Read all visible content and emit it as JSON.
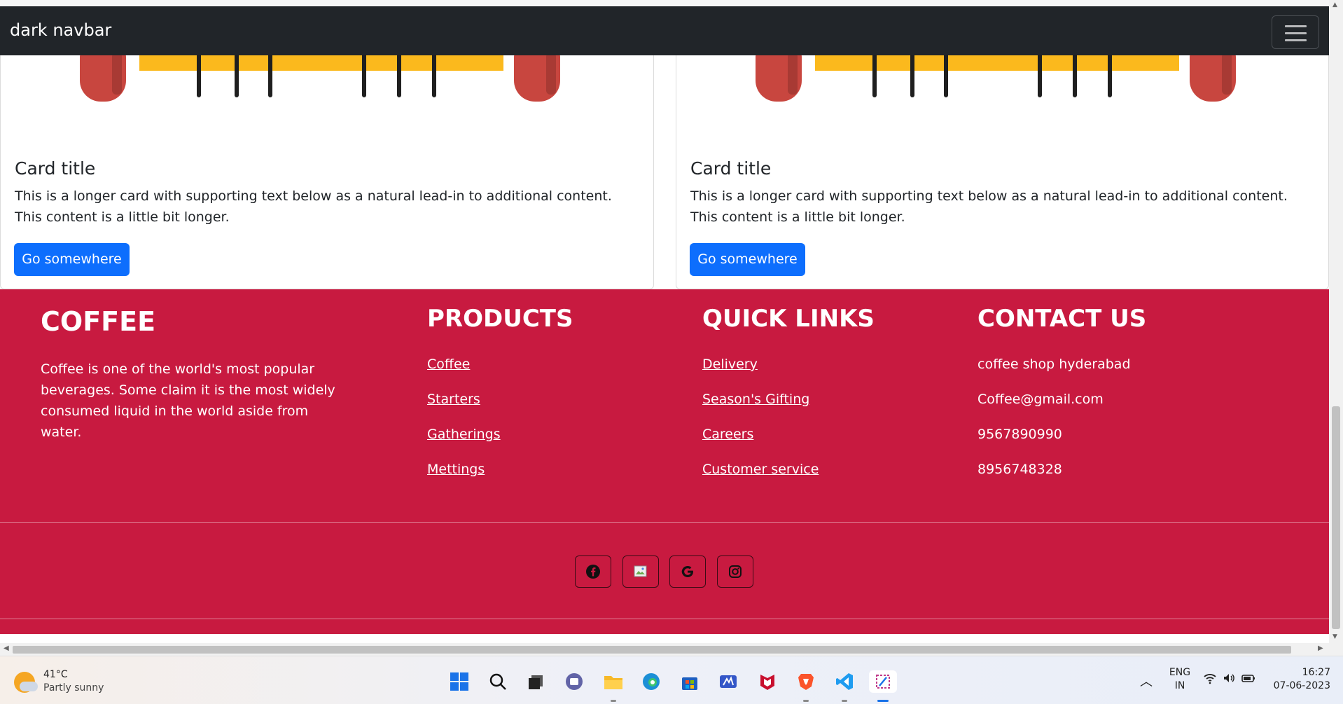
{
  "navbar": {
    "brand": "dark navbar",
    "toggler_icon": "hamburger-icon"
  },
  "cards": [
    {
      "title": "Card title",
      "text": "This is a longer card with supporting text below as a natural lead-in to additional content. This content is a little bit longer.",
      "button": "Go somewhere"
    },
    {
      "title": "Card title",
      "text": "This is a longer card with supporting text below as a natural lead-in to additional content. This content is a little bit longer.",
      "button": "Go somewhere"
    }
  ],
  "footer": {
    "about": {
      "title": "COFFEE",
      "text": "Coffee is one of the world's most popular beverages. Some claim it is the most widely consumed liquid in the world aside from water."
    },
    "products": {
      "title": "PRODUCTS",
      "links": [
        "Coffee",
        "Starters",
        "Gatherings",
        "Mettings"
      ]
    },
    "quick_links": {
      "title": "QUICK LINKS",
      "links": [
        "Delivery",
        "Season's Gifting",
        "Careers",
        "Customer service"
      ]
    },
    "contact": {
      "title": "CONTACT US",
      "items": [
        "coffee shop hyderabad",
        "Coffee@gmail.com",
        "9567890990",
        "8956748328"
      ]
    },
    "social": [
      "facebook-icon",
      "broken-image-icon",
      "google-icon",
      "instagram-icon"
    ],
    "colors": {
      "background": "#c81a40"
    }
  },
  "taskbar": {
    "weather": {
      "temp": "41°C",
      "condition": "Partly sunny"
    },
    "apps": [
      "windows-start-icon",
      "search-icon",
      "task-view-icon",
      "teams-chat-icon",
      "file-explorer-icon",
      "edge-icon",
      "store-icon",
      "whiteboard-icon",
      "mcafee-icon",
      "brave-icon",
      "vscode-icon",
      "snipping-tool-icon"
    ],
    "lang": {
      "line1": "ENG",
      "line2": "IN"
    },
    "clock": {
      "time": "16:27",
      "date": "07-06-2023"
    }
  }
}
